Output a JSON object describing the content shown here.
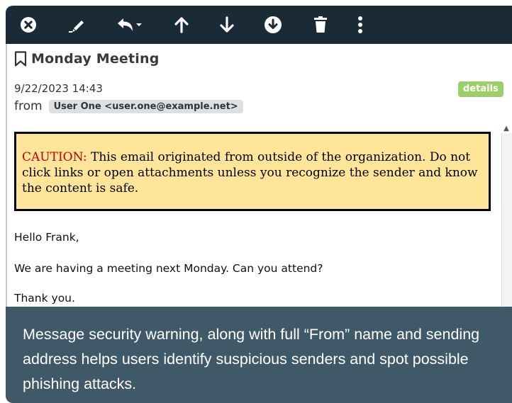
{
  "toolbar": {
    "icons": [
      "close-icon",
      "tag-icon",
      "reply-menu-icon",
      "previous-message-icon",
      "next-message-icon",
      "download-icon",
      "delete-icon",
      "more-icon"
    ],
    "background": "#1b2b35"
  },
  "message": {
    "subject": "Monday Meeting",
    "date": "9/22/2023 14:43",
    "details_label": "details",
    "from_label": "from",
    "sender": "User One <user.one@example.net>"
  },
  "caution": {
    "prefix": "CAUTION:",
    "text": " This email originated from outside of the organization. Do not click links or open attachments unless you recognize the sender and know the content is safe.",
    "background": "#ffe599",
    "prefix_color": "#c00000"
  },
  "body": {
    "greeting": "Hello Frank,",
    "line1": "We are having a meeting next Monday. Can you attend?",
    "closing": "Thank you."
  },
  "caption": {
    "text": "Message security warning, along with full “From” name and sending address helps users identify suspicious senders and spot possible phishing attacks.",
    "background": "#405968"
  }
}
